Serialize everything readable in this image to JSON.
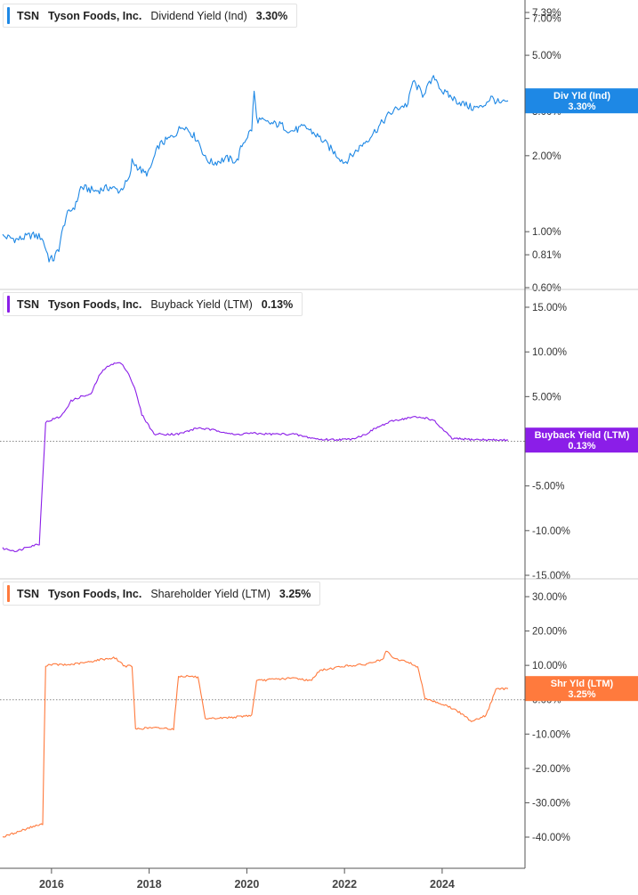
{
  "colors": {
    "div": "#1e88e5",
    "buy": "#8b1ee8",
    "shr": "#ff7a3d",
    "axis": "#555555",
    "grid": "#cccccc"
  },
  "chart_data": [
    {
      "type": "line",
      "ticker": "TSN",
      "company": "Tyson Foods, Inc.",
      "metric": "Dividend Yield (Ind)",
      "last_value": "3.30%",
      "tag_label": "Div Yld (Ind)",
      "scale": "log",
      "ylim": [
        0.6,
        7.39
      ],
      "yticks": [
        {
          "v": 7.39,
          "label": "7.39%"
        },
        {
          "v": 7.0,
          "label": "7.00%"
        },
        {
          "v": 5.0,
          "label": "5.00%"
        },
        {
          "v": 3.0,
          "label": "3.00%"
        },
        {
          "v": 2.0,
          "label": "2.00%"
        },
        {
          "v": 1.0,
          "label": "1.00%"
        },
        {
          "v": 0.81,
          "label": "0.81%"
        },
        {
          "v": 0.6,
          "label": "0.60%"
        }
      ],
      "x": [
        2015.0,
        2015.3,
        2015.6,
        2015.8,
        2015.95,
        2016.05,
        2016.15,
        2016.3,
        2016.5,
        2016.6,
        2016.9,
        2017.2,
        2017.4,
        2017.6,
        2017.65,
        2017.9,
        2018.0,
        2018.2,
        2018.5,
        2018.7,
        2019.0,
        2019.15,
        2019.3,
        2019.6,
        2019.8,
        2019.9,
        2020.1,
        2020.15,
        2020.2,
        2020.4,
        2020.7,
        2020.9,
        2021.2,
        2021.5,
        2021.8,
        2022.0,
        2022.2,
        2022.5,
        2022.7,
        2022.9,
        2023.1,
        2023.3,
        2023.4,
        2023.6,
        2023.85,
        2024.0,
        2024.3,
        2024.6,
        2024.8,
        2025.0,
        2025.2,
        2025.35
      ],
      "y": [
        0.96,
        0.93,
        0.97,
        0.95,
        0.78,
        0.78,
        0.86,
        1.15,
        1.28,
        1.5,
        1.45,
        1.5,
        1.45,
        1.62,
        1.9,
        1.7,
        1.72,
        2.2,
        2.4,
        2.65,
        2.3,
        1.95,
        1.87,
        1.95,
        1.9,
        2.2,
        2.55,
        3.6,
        2.8,
        2.7,
        2.65,
        2.5,
        2.6,
        2.35,
        2.05,
        1.88,
        2.05,
        2.35,
        2.6,
        2.9,
        3.1,
        3.2,
        3.95,
        3.5,
        4.1,
        3.6,
        3.3,
        3.1,
        3.1,
        3.4,
        3.2,
        3.3
      ]
    },
    {
      "type": "line",
      "ticker": "TSN",
      "company": "Tyson Foods, Inc.",
      "metric": "Buyback Yield (LTM)",
      "last_value": "0.13%",
      "tag_label": "Buyback Yield (LTM)",
      "scale": "linear",
      "ylim": [
        -15,
        15
      ],
      "yticks": [
        {
          "v": 15,
          "label": "15.00%"
        },
        {
          "v": 10,
          "label": "10.00%"
        },
        {
          "v": 5,
          "label": "5.00%"
        },
        {
          "v": -5,
          "label": "-5.00%"
        },
        {
          "v": -10,
          "label": "-10.00%"
        },
        {
          "v": -15,
          "label": "-15.00%"
        }
      ],
      "x": [
        2015.0,
        2015.3,
        2015.5,
        2015.75,
        2015.88,
        2016.0,
        2016.2,
        2016.4,
        2016.6,
        2016.8,
        2017.0,
        2017.2,
        2017.4,
        2017.55,
        2017.7,
        2017.85,
        2018.1,
        2018.6,
        2019.0,
        2019.5,
        2019.75,
        2020.0,
        2020.5,
        2020.95,
        2021.2,
        2021.5,
        2021.9,
        2022.1,
        2022.4,
        2022.65,
        2023.0,
        2023.4,
        2023.7,
        2023.85,
        2024.2,
        2024.6,
        2025.0,
        2025.35
      ],
      "y": [
        -12.0,
        -12.3,
        -11.8,
        -11.5,
        2.1,
        2.4,
        2.8,
        4.5,
        5.0,
        5.2,
        7.6,
        8.6,
        8.8,
        7.9,
        6.0,
        3.0,
        0.8,
        0.8,
        1.5,
        1.1,
        0.7,
        0.9,
        0.8,
        0.8,
        0.5,
        0.2,
        0.2,
        0.2,
        0.7,
        1.5,
        2.3,
        2.7,
        2.6,
        2.2,
        0.3,
        0.2,
        0.15,
        0.13
      ]
    },
    {
      "type": "line",
      "ticker": "TSN",
      "company": "Tyson Foods, Inc.",
      "metric": "Shareholder Yield (LTM)",
      "last_value": "3.25%",
      "tag_label": "Shr Yld (LTM)",
      "scale": "linear",
      "ylim": [
        -40,
        30
      ],
      "yticks": [
        {
          "v": 30,
          "label": "30.00%"
        },
        {
          "v": 20,
          "label": "20.00%"
        },
        {
          "v": 10,
          "label": "10.00%"
        },
        {
          "v": 0,
          "label": "0.00%"
        },
        {
          "v": -10,
          "label": "-10.00%"
        },
        {
          "v": -20,
          "label": "-20.00%"
        },
        {
          "v": -30,
          "label": "-30.00%"
        },
        {
          "v": -40,
          "label": "-40.00%"
        }
      ],
      "x": [
        2015.0,
        2015.3,
        2015.6,
        2015.82,
        2015.88,
        2016.0,
        2016.3,
        2016.7,
        2017.0,
        2017.3,
        2017.5,
        2017.65,
        2017.72,
        2018.0,
        2018.3,
        2018.5,
        2018.6,
        2018.8,
        2019.0,
        2019.15,
        2019.3,
        2019.8,
        2020.1,
        2020.2,
        2020.6,
        2021.0,
        2021.3,
        2021.5,
        2021.8,
        2022.0,
        2022.4,
        2022.8,
        2022.85,
        2023.0,
        2023.3,
        2023.5,
        2023.65,
        2023.9,
        2024.1,
        2024.3,
        2024.6,
        2024.9,
        2025.1,
        2025.35
      ],
      "y": [
        -40,
        -38.5,
        -37,
        -36.2,
        10.0,
        10.3,
        10.1,
        10.8,
        11.7,
        12.2,
        9.8,
        9.8,
        -8.5,
        -8.2,
        -8.3,
        -8.5,
        6.8,
        6.9,
        6.5,
        -5.8,
        -5.5,
        -5.0,
        -4.5,
        5.5,
        6.0,
        6.3,
        5.5,
        8.5,
        9.3,
        9.8,
        10.2,
        11.8,
        14.3,
        12.0,
        11.0,
        9.5,
        0.5,
        -0.8,
        -1.8,
        -3.2,
        -6.2,
        -4.6,
        3.0,
        3.25
      ]
    }
  ],
  "x_axis": {
    "ticks": [
      {
        "v": 2016,
        "label": "2016"
      },
      {
        "v": 2018,
        "label": "2018"
      },
      {
        "v": 2020,
        "label": "2020"
      },
      {
        "v": 2022,
        "label": "2022"
      },
      {
        "v": 2024,
        "label": "2024"
      }
    ],
    "range": [
      2015.0,
      2025.35
    ]
  }
}
